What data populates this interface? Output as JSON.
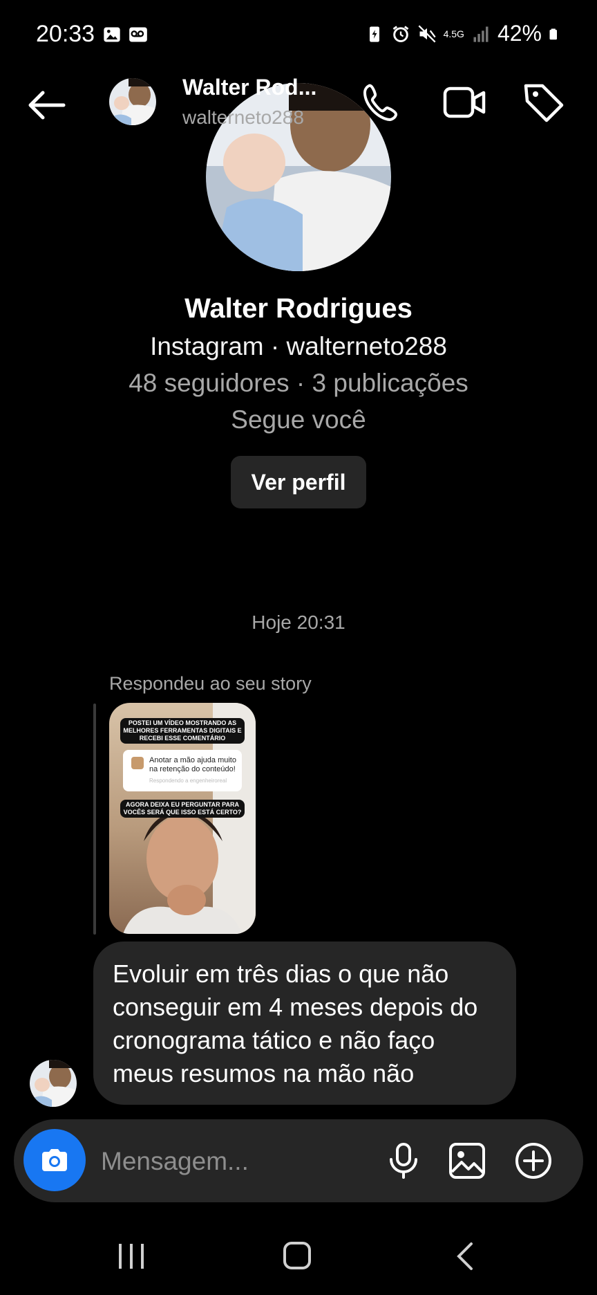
{
  "status_bar": {
    "time": "20:33",
    "network": "4.5G",
    "battery": "42%",
    "icons_left": [
      "image-icon",
      "voicemail-icon"
    ],
    "icons_right": [
      "battery-saver-icon",
      "alarm-icon",
      "mute-icon",
      "network-icon",
      "signal-icon",
      "battery-icon"
    ]
  },
  "header": {
    "name": "Walter Rod...",
    "username": "walterneto288",
    "actions": [
      "phone-icon",
      "video-icon",
      "tag-icon"
    ]
  },
  "profile": {
    "name": "Walter Rodrigues",
    "line1": "Instagram · walterneto288",
    "line2": "48 seguidores · 3 publicações",
    "line3": "Segue você",
    "button": "Ver perfil"
  },
  "thread": {
    "timestamp": "Hoje 20:31",
    "story_caption": "Respondeu ao seu story",
    "story": {
      "text_top": "POSTEI UM VÍDEO MOSTRANDO AS MELHORES FERRAMENTAS DIGITAIS E RECEBI ESSE COMENTÁRIO",
      "comment": "Anotar a mão ajuda muito na retenção do conteúdo!",
      "comment_sub": "Respondendo a engenheiroreal",
      "text_bottom": "AGORA DEIXA EU PERGUNTAR PARA VOCÊS SERÁ QUE ISSO ESTÁ CERTO?"
    },
    "message": "Evoluir em três dias o que não conseguir em 4 meses depois do cronograma tático e não faço meus resumos na mão não"
  },
  "composer": {
    "placeholder": "Mensagem...",
    "camera_color": "#1877f2"
  },
  "nav": [
    "recent-apps-icon",
    "home-icon",
    "back-icon"
  ]
}
